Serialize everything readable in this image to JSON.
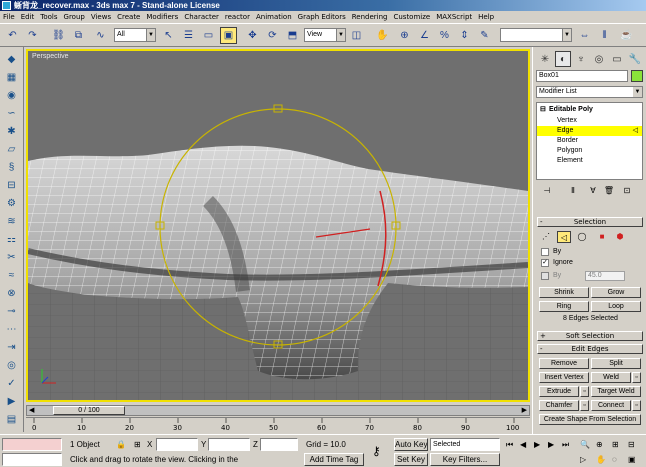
{
  "window": {
    "title": "蜥背龙_recover.max - 3ds max 7 - Stand-alone License"
  },
  "menu": [
    "File",
    "Edit",
    "Tools",
    "Group",
    "Views",
    "Create",
    "Modifiers",
    "Character",
    "reactor",
    "Animation",
    "Graph Editors",
    "Rendering",
    "Customize",
    "MAXScript",
    "Help"
  ],
  "toolbar": {
    "selection_filter": "All",
    "reference_coord": "View"
  },
  "viewport": {
    "label": "Perspective"
  },
  "timeline": {
    "slider_label": "0 / 100",
    "ticks": [
      "0",
      "10",
      "20",
      "30",
      "40",
      "50",
      "60",
      "70",
      "80",
      "90",
      "100"
    ]
  },
  "status": {
    "selection_count": "1 Object",
    "x_label": "X",
    "y_label": "Y",
    "z_label": "Z",
    "grid": "Grid = 10.0",
    "prompt": "Click and drag to rotate the view.  Clicking in the",
    "add_time_tag": "Add Time Tag",
    "auto_key": "Auto Key",
    "set_key": "Set Key",
    "key_mode": "Selected",
    "key_filters": "Key Filters..."
  },
  "command_panel": {
    "object_name": "Box01",
    "object_color": "#8ae23a",
    "modifier_list": "Modifier List",
    "stack": {
      "root": "Editable Poly",
      "levels": [
        "Vertex",
        "Edge",
        "Border",
        "Polygon",
        "Element"
      ],
      "selected_level": "Edge"
    },
    "selection": {
      "title": "Selection",
      "by_label": "By",
      "ignore_label": "Ignore",
      "by_angle_label": "By",
      "angle_value": "45.0",
      "shrink": "Shrink",
      "grow": "Grow",
      "ring": "Ring",
      "loop": "Loop",
      "info": "8 Edges Selected"
    },
    "soft_selection": {
      "title": "Soft Selection"
    },
    "edit_edges": {
      "title": "Edit Edges",
      "remove": "Remove",
      "split": "Split",
      "insert_vertex": "Insert Vertex",
      "weld": "Weld",
      "extrude": "Extrude",
      "target_weld": "Target Weld",
      "chamfer": "Chamfer",
      "connect": "Connect",
      "create_shape": "Create Shape From Selection"
    }
  },
  "colors": {
    "viewport_bg": "#6f6f6f",
    "highlight": "#ffff00",
    "active_border": "#f0e000",
    "gizmo": "#c8b400"
  }
}
